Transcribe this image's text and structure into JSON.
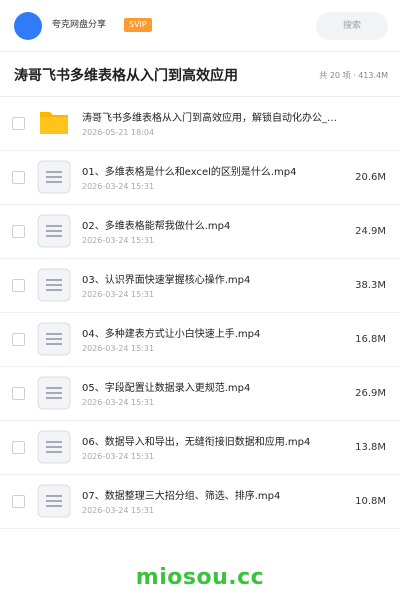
{
  "topbar": {
    "brand": "夸克网盘分享",
    "badge": "SVIP",
    "search_placeholder": "搜索"
  },
  "header": {
    "title": "涛哥飞书多维表格从入门到高效应用",
    "summary": "共 20 项 · 413.4M"
  },
  "files": [
    {
      "icon": "folder-icon",
      "name": "涛哥飞书多维表格从入门到高效应用，解锁自动化办公_…",
      "date": "2026-05-21 18:04",
      "size": ""
    },
    {
      "icon": "video-file-icon",
      "name": "01、多维表格是什么和excel的区别是什么.mp4",
      "date": "2026-03-24 15:31",
      "size": "20.6M"
    },
    {
      "icon": "video-file-icon",
      "name": "02、多维表格能帮我做什么.mp4",
      "date": "2026-03-24 15:31",
      "size": "24.9M"
    },
    {
      "icon": "video-file-icon",
      "name": "03、认识界面快速掌握核心操作.mp4",
      "date": "2026-03-24 15:31",
      "size": "38.3M"
    },
    {
      "icon": "video-file-icon",
      "name": "04、多种建表方式让小白快速上手.mp4",
      "date": "2026-03-24 15:31",
      "size": "16.8M"
    },
    {
      "icon": "video-file-icon",
      "name": "05、字段配置让数据录入更规范.mp4",
      "date": "2026-03-24 15:31",
      "size": "26.9M"
    },
    {
      "icon": "video-file-icon",
      "name": "06、数据导入和导出，无缝衔接旧数据和应用.mp4",
      "date": "2026-03-24 15:31",
      "size": "13.8M"
    },
    {
      "icon": "video-file-icon",
      "name": "07、数据整理三大招分组、筛选、排序.mp4",
      "date": "2026-03-24 15:31",
      "size": "10.8M"
    }
  ],
  "watermark": "miosou.cc",
  "colors": {
    "accent": "#2f7cf6",
    "badge": "#ff9a2e",
    "folder": "#ffc41c",
    "watermark": "#3cc23c"
  }
}
